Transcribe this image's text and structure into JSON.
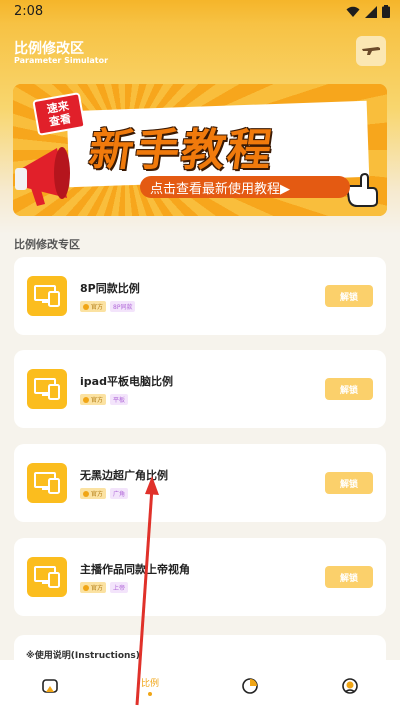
{
  "status_bar": {
    "time": "2:08"
  },
  "header": {
    "title": "比例修改区",
    "subtitle": "Parameter Simulator",
    "right_icon": "gun-icon"
  },
  "banner": {
    "stamp_line1": "速来",
    "stamp_line2": "查看",
    "title": "新手教程",
    "cta": "点击查看最新使用教程▶"
  },
  "section": {
    "title": "比例修改专区"
  },
  "cards": [
    {
      "name": "8P同款比例",
      "official": "官方",
      "tag": "8P同款",
      "unlock": "解锁"
    },
    {
      "name": "ipad平板电脑比例",
      "official": "官方",
      "tag": "平板",
      "unlock": "解锁"
    },
    {
      "name": "无黑边超广角比例",
      "official": "官方",
      "tag": "广角",
      "unlock": "解锁"
    },
    {
      "name": "主播作品同款上帝视角",
      "official": "官方",
      "tag": "上帝",
      "unlock": "解锁"
    }
  ],
  "instructions": {
    "label": "※使用说明(Instructions)"
  },
  "bottom_nav": {
    "tabs": [
      {
        "icon": "home-icon",
        "label": ""
      },
      {
        "icon": "ratio-icon",
        "label": "比例"
      },
      {
        "icon": "chart-icon",
        "label": ""
      },
      {
        "icon": "profile-icon",
        "label": ""
      }
    ],
    "active_index": 1
  },
  "colors": {
    "accent": "#f0a516",
    "header": "#f7c244",
    "unlock_button": "#fbd06b",
    "arrow": "#e0312a"
  }
}
